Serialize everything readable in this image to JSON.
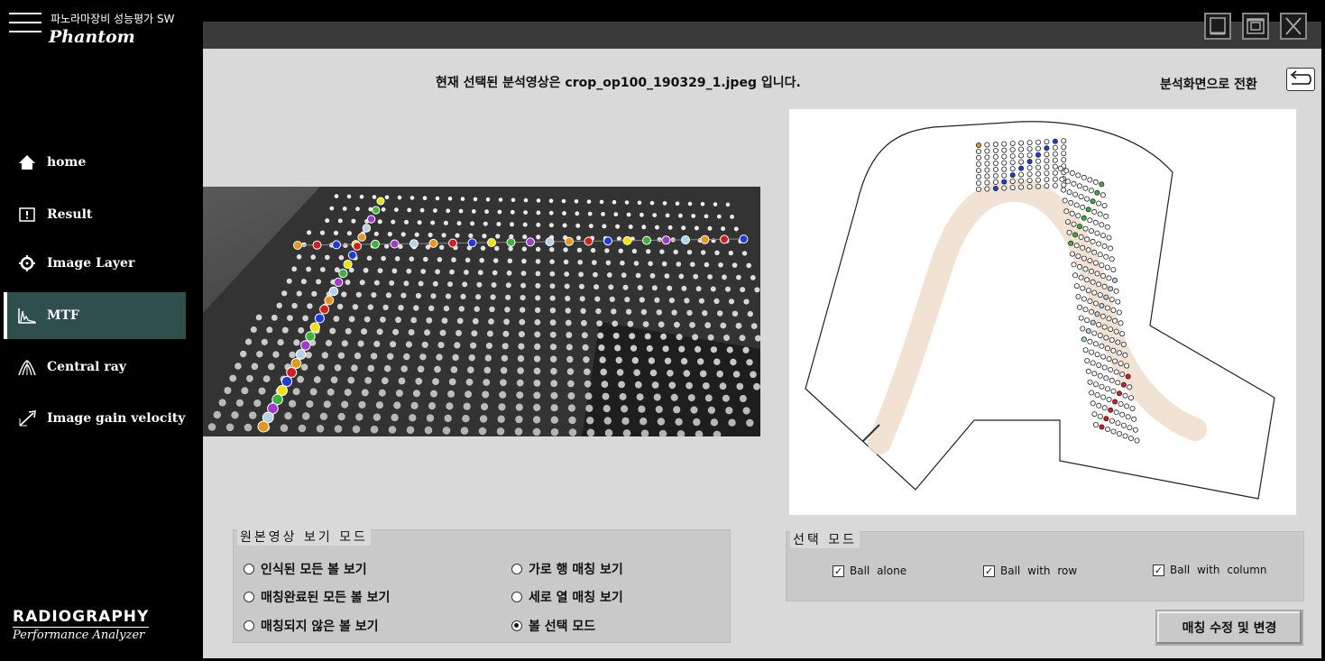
{
  "app": {
    "subtitle": "파노라마장비 성능평가 SW",
    "name": "Phantom"
  },
  "sidebar": {
    "items": [
      {
        "label": "home",
        "icon": "home-icon",
        "active": false
      },
      {
        "label": "Result",
        "icon": "result-icon",
        "active": false
      },
      {
        "label": "Image Layer",
        "icon": "image-layer-icon",
        "active": false
      },
      {
        "label": "MTF",
        "icon": "mtf-icon",
        "active": true
      },
      {
        "label": "Central ray",
        "icon": "central-ray-icon",
        "active": false
      },
      {
        "label": "Image gain velocity",
        "icon": "image-gain-velocity-icon",
        "active": false
      }
    ],
    "brand_title": "RADIOGRAPHY",
    "brand_subtitle": "Performance Analyzer"
  },
  "window_controls": [
    "minimize-icon",
    "restore-icon",
    "close-icon"
  ],
  "main": {
    "header_message": "현재 선택된 분석영상은 crop_op100_190329_1.jpeg 입니다.",
    "switch_label": "분석화면으로 전환",
    "switch_icon": "return-arrow-icon"
  },
  "view_mode": {
    "title": "원본영상 보기 모드",
    "options": [
      {
        "label": "인식된 모든 볼 보기",
        "checked": false
      },
      {
        "label": "매칭완료된 모든 볼 보기",
        "checked": false
      },
      {
        "label": "매칭되지 않은 볼 보기",
        "checked": false
      },
      {
        "label": "가로 행 매칭 보기",
        "checked": false
      },
      {
        "label": "세로 열 매칭 보기",
        "checked": false
      },
      {
        "label": "볼 선택 모드",
        "checked": true
      }
    ]
  },
  "select_mode": {
    "title": "선택 모드",
    "options": [
      {
        "label": "Ball alone",
        "checked": true
      },
      {
        "label": "Ball with row",
        "checked": true
      },
      {
        "label": "Ball with column",
        "checked": true
      }
    ]
  },
  "edit_button": "매칭 수정 및 변경",
  "colors": {
    "sidebar_bg": "#000000",
    "active_item": "#2f4f4c",
    "main_bg": "#d9d9d9",
    "titlebar": "#3a3a3a",
    "ball_colors": [
      "#e8961e",
      "#d21e1e",
      "#1e3cdc",
      "#f0e10a",
      "#3cb43c",
      "#a03cc8",
      "#b4d2e6"
    ]
  }
}
